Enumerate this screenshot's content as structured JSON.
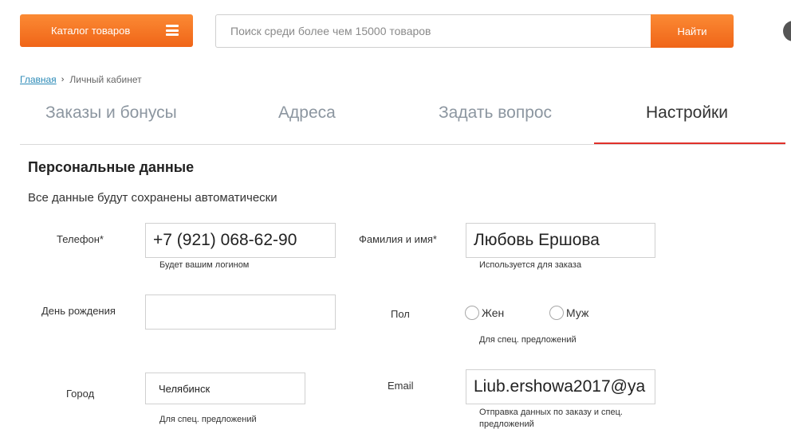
{
  "header": {
    "catalog_label": "Каталог товаров",
    "search_placeholder": "Поиск среди более чем 15000 товаров",
    "search_button": "Найти"
  },
  "breadcrumb": {
    "home": "Главная",
    "separator": "›",
    "current": "Личный кабинет"
  },
  "tabs": [
    {
      "label": "Заказы и бонусы",
      "active": false
    },
    {
      "label": "Адреса",
      "active": false
    },
    {
      "label": "Задать вопрос",
      "active": false
    },
    {
      "label": "Настройки",
      "active": true
    }
  ],
  "section": {
    "title": "Персональные данные",
    "note": "Все данные будут сохранены автоматически"
  },
  "form": {
    "phone": {
      "label": "Телефон*",
      "value": "+7 (921) 068-62-90",
      "hint": "Будет вашим логином"
    },
    "name": {
      "label": "Фамилия и имя*",
      "value": "Любовь Ершова",
      "hint": "Используется для заказа"
    },
    "birthday": {
      "label": "День рождения",
      "value": ""
    },
    "gender": {
      "label": "Пол",
      "options": [
        "Жен",
        "Муж"
      ],
      "hint": "Для спец. предложений"
    },
    "city": {
      "label": "Город",
      "value": "Челябинск",
      "hint": "Для спец. предложений"
    },
    "email": {
      "label": "Email",
      "value": "Liub.ershowa2017@ya",
      "hint_line1": "Отправка данных по заказу и спец.",
      "hint_line2": "предложений"
    }
  },
  "colors": {
    "accent_orange": "#f47a28",
    "active_tab_underline": "#e0312a",
    "link": "#2b8ab7"
  }
}
